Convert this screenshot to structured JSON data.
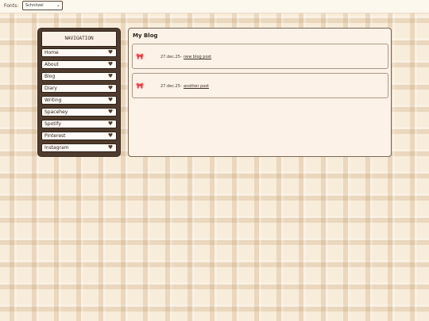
{
  "font_bar": {
    "label": "Fonts:",
    "selected": "Schnitzel"
  },
  "navigation": {
    "title": "NAVIGATION",
    "items": [
      {
        "label": "Home"
      },
      {
        "label": "About"
      },
      {
        "label": "Blog"
      },
      {
        "label": "Diary"
      },
      {
        "label": "Writing"
      },
      {
        "label": "Spacehey"
      },
      {
        "label": "Spotify"
      },
      {
        "label": "Pinterest"
      },
      {
        "label": "Instagram"
      }
    ],
    "item_icon": "heart-icon"
  },
  "blog": {
    "title": "My Blog",
    "posts": [
      {
        "date": "27.dec.25",
        "separator": "-",
        "title": "new blog post",
        "icon": "bow-icon"
      },
      {
        "date": "27.dec.25",
        "separator": "-",
        "title": "another post",
        "icon": "bow-icon"
      }
    ]
  },
  "colors": {
    "background": "#f8ecda",
    "nav_frame": "#4f3c2e",
    "panel": "#fdf2e7"
  }
}
